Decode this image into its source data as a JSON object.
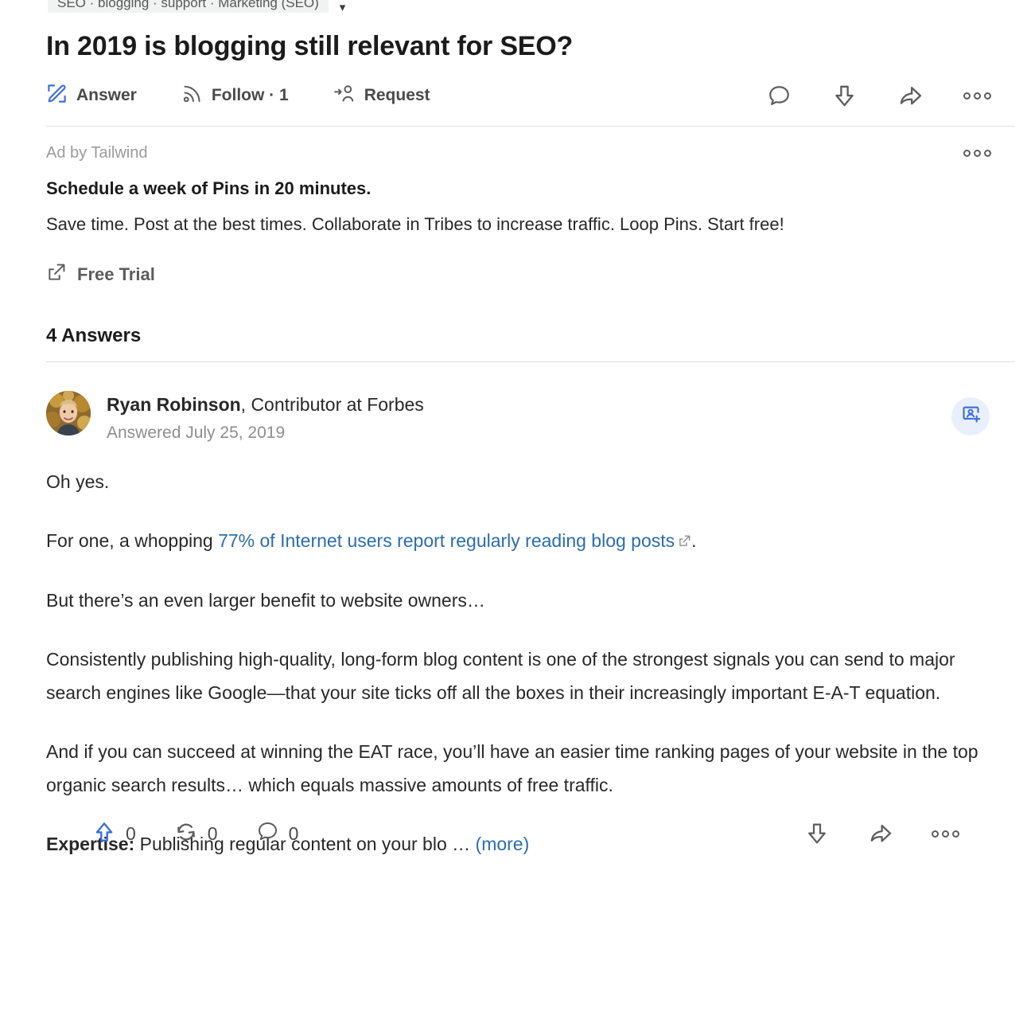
{
  "topic": {
    "chip_label": "SEO · blogging · support · Marketing (SEO)",
    "caret_icon": "caret-down-icon"
  },
  "question": {
    "title": "In 2019 is blogging still relevant for SEO?"
  },
  "actions": {
    "answer": {
      "label": "Answer",
      "icon": "pencil-answer-icon"
    },
    "follow": {
      "label": "Follow · 1",
      "icon": "rss-follow-icon"
    },
    "request": {
      "label": "Request",
      "icon": "request-person-icon"
    },
    "comment_icon": "comment-bubble-icon",
    "downvote_icon": "downvote-arrow-icon",
    "share_icon": "share-arrow-icon",
    "more_icon": "more-options-icon"
  },
  "ad": {
    "sponsor_label": "Ad by Tailwind",
    "headline": "Schedule a week of Pins in 20 minutes.",
    "body": "Save time. Post at the best times. Collaborate in Tribes to increase traffic. Loop Pins. Start free!",
    "cta_label": "Free Trial",
    "cta_icon": "external-link-icon",
    "more_icon": "ad-more-options-icon"
  },
  "answers_section": {
    "count_label": "4 Answers"
  },
  "answer": {
    "author_name": "Ryan Robinson",
    "author_credential": ", Contributor at Forbes",
    "answered_date": "Answered July 25, 2019",
    "follow_user_icon": "add-person-icon",
    "avatar_alt": "avatar",
    "paragraphs": [
      "Oh yes.",
      "But there’s an even larger benefit to website owners…",
      "Consistently publishing high-quality, long-form blog content is one of the strongest signals you can send to major search engines like Google—that your site ticks off all the boxes in their increasingly important E-A-T equation.",
      "And if you can succeed at winning the EAT race, you’ll have an easier time ranking pages of your website in the top organic search results… which equals massive amounts of free traffic."
    ],
    "link_paragraph": {
      "prefix": "For one, a whopping ",
      "link_text": "77% of Internet users report regularly reading blog posts",
      "suffix": ".",
      "link_icon": "external-link-icon"
    },
    "expertise": {
      "label": "Expertise:",
      "text": " Publishing regular content on your blo … ",
      "more_label": "(more)"
    },
    "footer": {
      "upvote": {
        "icon": "upvote-arrow-icon",
        "count": "0"
      },
      "repost": {
        "icon": "repost-icon",
        "count": "0"
      },
      "comment": {
        "icon": "comment-bubble-icon",
        "count": "0"
      },
      "downvote_icon": "downvote-arrow-icon",
      "share_icon": "share-arrow-icon",
      "more_icon": "more-options-icon"
    }
  },
  "colors": {
    "accent_blue": "#3c6ee0",
    "link_blue": "#2b6dad",
    "text": "#282829",
    "muted": "#8e8e8e",
    "divider": "#e0e1e2",
    "follow_pill_bg": "#eaeffc"
  }
}
